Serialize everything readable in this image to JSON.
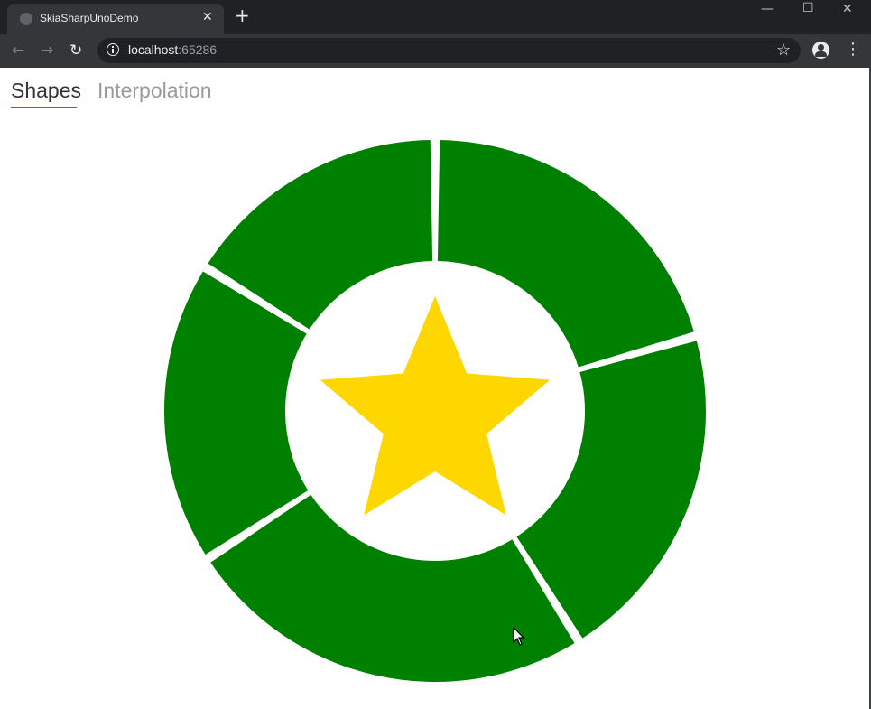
{
  "browser": {
    "tab_title": "SkiaSharpUnoDemo",
    "url_host": "localhost",
    "url_port": ":65286",
    "window_controls": [
      "minimize-icon",
      "maximize-icon",
      "close-icon"
    ],
    "dark_chrome_color": "#202124"
  },
  "app": {
    "pivot_tabs": [
      {
        "label": "Shapes",
        "active": true
      },
      {
        "label": "Interpolation",
        "active": false
      }
    ]
  },
  "drawing": {
    "donut_color": "#008000",
    "star_color": "#FFD700",
    "segment_count": 5,
    "star_points": 5
  }
}
